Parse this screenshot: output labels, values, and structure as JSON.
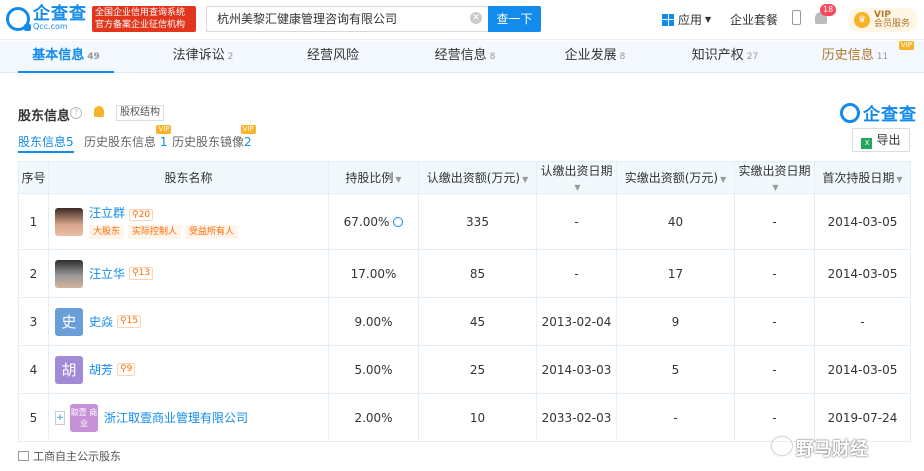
{
  "brand": {
    "name": "企查查",
    "sub": "Qcc.com",
    "slogan": "全国企业信用查询系统 官方备案企业征信机构"
  },
  "search": {
    "value": "杭州美黎汇健康管理咨询有限公司",
    "button": "查一下"
  },
  "header": {
    "apps": "应用",
    "suite": "企业套餐",
    "notify_count": "18",
    "vip_label": "VIP",
    "vip_sub": "会员服务"
  },
  "tabs": [
    {
      "label": "基本信息",
      "count": "49"
    },
    {
      "label": "法律诉讼",
      "count": "2"
    },
    {
      "label": "经营风险",
      "count": ""
    },
    {
      "label": "经营信息",
      "count": "8"
    },
    {
      "label": "企业发展",
      "count": "8"
    },
    {
      "label": "知识产权",
      "count": "27"
    },
    {
      "label": "历史信息",
      "count": "11"
    }
  ],
  "section": {
    "title": "股东信息",
    "equity_btn": "股权结构",
    "brand": "企查查",
    "export": "导出",
    "vip": "VIP"
  },
  "subtabs": [
    {
      "label": "股东信息",
      "count": "5"
    },
    {
      "label": "历史股东信息",
      "count": "1"
    },
    {
      "label": "历史股东镜像",
      "count": "2"
    }
  ],
  "columns": [
    "序号",
    "股东名称",
    "持股比例",
    "认缴出资额(万元)",
    "认缴出资日期",
    "实缴出资额(万元)",
    "实缴出资日期",
    "首次持股日期"
  ],
  "rows": [
    {
      "idx": "1",
      "name": "汪立群",
      "avatar": "",
      "rel": "20",
      "tags": [
        "大股东",
        "实际控制人",
        "受益所有人"
      ],
      "pct": "67.00%",
      "sub_amt": "335",
      "sub_date": "-",
      "paid_amt": "40",
      "paid_date": "-",
      "first": "2014-03-05"
    },
    {
      "idx": "2",
      "name": "汪立华",
      "avatar": "",
      "rel": "13",
      "tags": [],
      "pct": "17.00%",
      "sub_amt": "85",
      "sub_date": "-",
      "paid_amt": "17",
      "paid_date": "-",
      "first": "2014-03-05"
    },
    {
      "idx": "3",
      "name": "史焱",
      "avatar": "史",
      "rel": "15",
      "tags": [],
      "pct": "9.00%",
      "sub_amt": "45",
      "sub_date": "2013-02-04",
      "paid_amt": "9",
      "paid_date": "-",
      "first": "-"
    },
    {
      "idx": "4",
      "name": "胡芳",
      "avatar": "胡",
      "rel": "9",
      "tags": [],
      "pct": "5.00%",
      "sub_amt": "25",
      "sub_date": "2014-03-03",
      "paid_amt": "5",
      "paid_date": "-",
      "first": "2014-03-05"
    },
    {
      "idx": "5",
      "name": "浙江取壹商业管理有限公司",
      "avatar": "取壹 商业",
      "rel": "",
      "tags": [],
      "pct": "2.00%",
      "sub_amt": "10",
      "sub_date": "2033-02-03",
      "paid_amt": "-",
      "paid_date": "-",
      "first": "2019-07-24"
    }
  ],
  "footer": {
    "label": "工商自主公示股东"
  },
  "watermark": "野马财经"
}
